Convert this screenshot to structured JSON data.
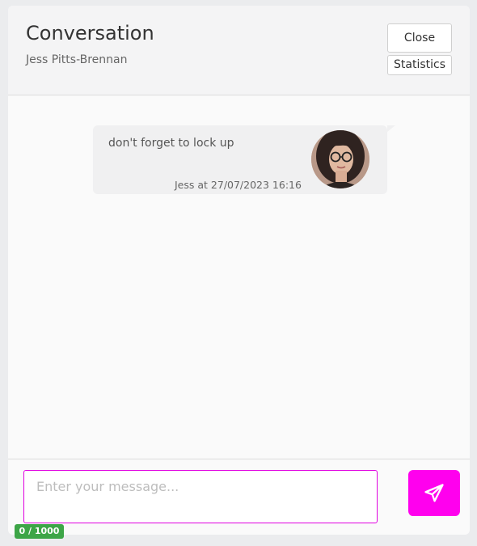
{
  "header": {
    "title": "Conversation",
    "subtitle": "Jess Pitts-Brennan",
    "close_label": "Close",
    "statistics_label": "Statistics"
  },
  "messages": [
    {
      "text": "don't forget to lock up",
      "meta": "Jess at 27/07/2023 16:16",
      "avatar": "user-avatar-photo"
    }
  ],
  "composer": {
    "placeholder": "Enter your message...",
    "value": "",
    "counter": "0 / 1000",
    "send_icon": "paper-plane-icon"
  },
  "colors": {
    "accent": "#ff00ee",
    "counter_badge": "#3da547",
    "input_border": "#e000e0"
  }
}
